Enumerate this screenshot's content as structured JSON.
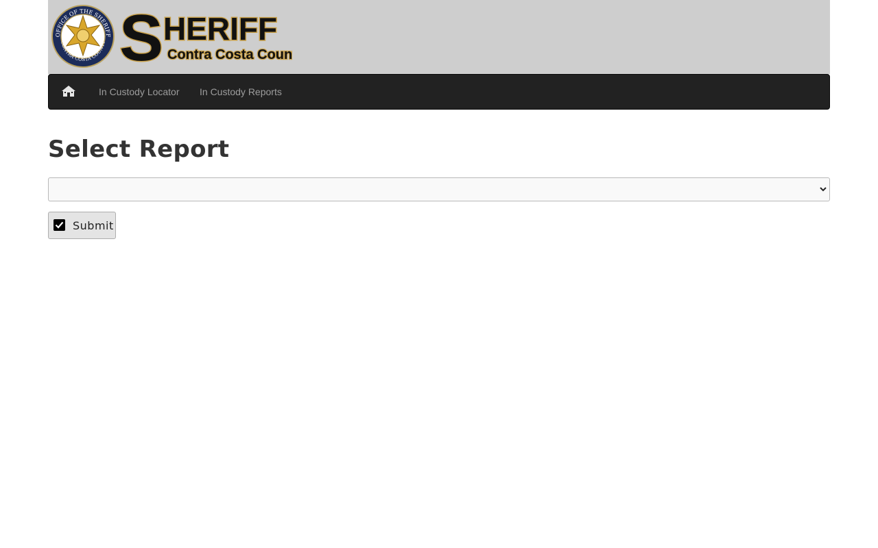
{
  "header": {
    "logo_text_main": "SHERIFF",
    "logo_text_sub": "Contra Costa County",
    "seal_text_top": "OFFICE OF THE SHERIFF",
    "seal_text_bottom": "CONTRA COSTA COUNTY"
  },
  "nav": {
    "home_icon": "home-icon",
    "items": [
      {
        "label": "In Custody Locator"
      },
      {
        "label": "In Custody Reports"
      }
    ]
  },
  "main": {
    "title": "Select Report",
    "report_select": {
      "selected": ""
    },
    "submit_label": "Submit",
    "submit_icon": "check-icon"
  },
  "colors": {
    "banner_bg": "#cecece",
    "navbar_bg": "#222222",
    "nav_text": "#9d9d9d",
    "logo_gold": "#c9a14a",
    "title_text": "#333333"
  }
}
